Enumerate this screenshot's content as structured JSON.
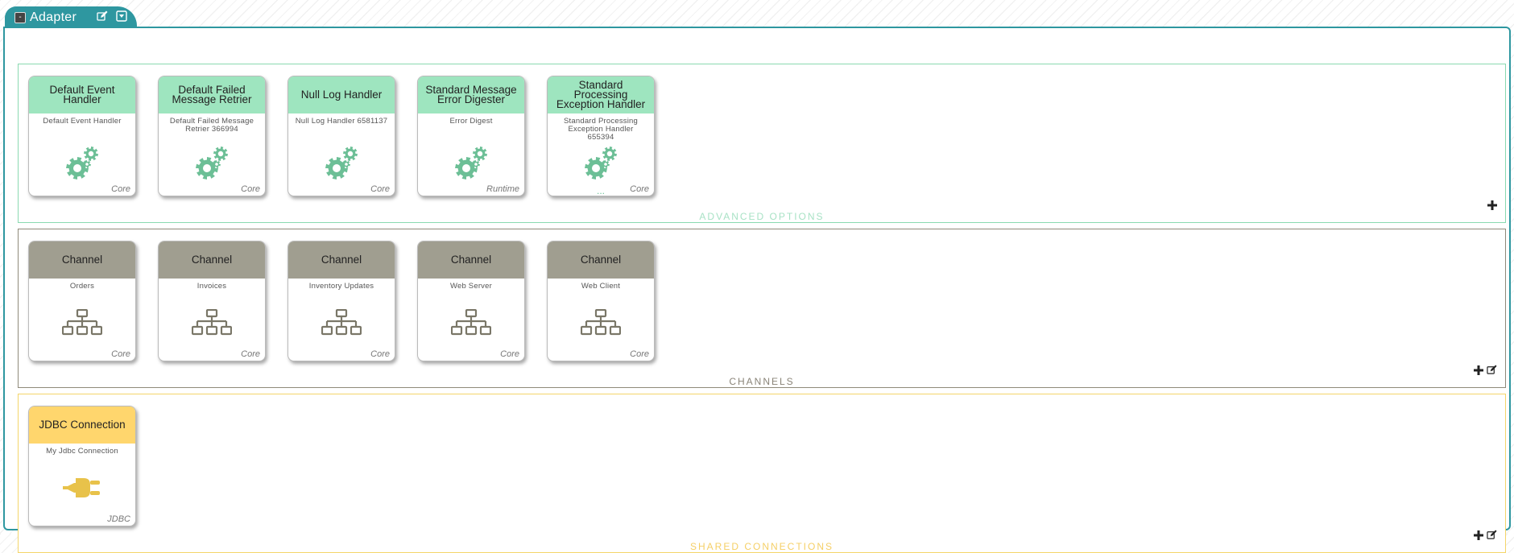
{
  "header": {
    "title": "Adapter",
    "collapse_symbol": "-",
    "icons": [
      "collapse-icon",
      "edit-icon",
      "dropdown-menu-icon"
    ]
  },
  "colors": {
    "frame": "#2e97a0",
    "advanced_head": "#9ee5bf",
    "advanced_icon": "#6cbf96",
    "channel_head": "#a09e90",
    "channel_icon": "#7a7768",
    "connection_head": "#ffd66d",
    "connection_icon": "#e8c24a"
  },
  "advanced": {
    "label": "ADVANCED OPTIONS",
    "actions": [
      "add-icon"
    ],
    "cards": [
      {
        "title": "Default Event Handler",
        "name": "Default Event Handler",
        "category": "Core",
        "icon": "gears-icon"
      },
      {
        "title": "Default Failed Message Retrier",
        "name": "Default Failed Message Retrier 366994",
        "category": "Core",
        "icon": "gears-icon"
      },
      {
        "title": "Null Log Handler",
        "name": "Null Log Handler 6581137",
        "category": "Core",
        "icon": "gears-icon"
      },
      {
        "title": "Standard Message Error Digester",
        "name": "Error Digest",
        "category": "Runtime",
        "icon": "gears-icon"
      },
      {
        "title": "Standard Processing Exception Handler",
        "name": "Standard Processing Exception Handler 655394",
        "category": "Core",
        "icon": "gears-icon",
        "more": "..."
      }
    ]
  },
  "channels": {
    "label": "CHANNELS",
    "actions": [
      "add-icon",
      "edit-icon"
    ],
    "cards": [
      {
        "title": "Channel",
        "name": "Orders",
        "category": "Core",
        "icon": "sitemap-icon"
      },
      {
        "title": "Channel",
        "name": "Invoices",
        "category": "Core",
        "icon": "sitemap-icon"
      },
      {
        "title": "Channel",
        "name": "Inventory Updates",
        "category": "Core",
        "icon": "sitemap-icon"
      },
      {
        "title": "Channel",
        "name": "Web Server",
        "category": "Core",
        "icon": "sitemap-icon"
      },
      {
        "title": "Channel",
        "name": "Web Client",
        "category": "Core",
        "icon": "sitemap-icon"
      }
    ]
  },
  "connections": {
    "label": "SHARED CONNECTIONS",
    "actions": [
      "add-icon",
      "edit-icon"
    ],
    "cards": [
      {
        "title": "JDBC Connection",
        "name": "My Jdbc Connection",
        "category": "JDBC",
        "icon": "plug-icon"
      }
    ]
  }
}
